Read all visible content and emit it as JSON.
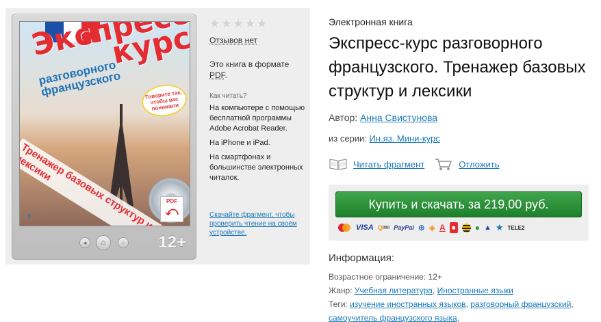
{
  "cover": {
    "title_line1": "Экспресс-",
    "title_line2": "курс",
    "subtitle": "разговорного французского",
    "note": "Говорите так, чтобы вас понимали",
    "diagonal_text": "Тренажер базовых структур и лексики",
    "pdf_badge": "PDF",
    "publisher_mark": "э"
  },
  "device": {
    "age_badge": "12+"
  },
  "panel": {
    "stars": "★★★★★",
    "reviews": "Отзывов нет",
    "format_prefix": "Это книга в формате ",
    "format_pdf": "PDF",
    "format_suffix": ".",
    "howto_label": "Как читать?",
    "howto_computer": "На компьютере с помощью бесплатной программы Adobe Acrobat Reader.",
    "howto_iphone": "На iPhone и iPad.",
    "howto_phones": "На смартфонах и большинстве электронных читалок.",
    "fragment_link": "Скачайте фрагмент, чтобы проверить чтение на своём устройстве."
  },
  "book": {
    "type_label": "Электронная книга",
    "title": "Экспресс-курс разговорного французского. Тренажер базовых структур и лексики",
    "author_label": "Автор: ",
    "author_name": "Анна Свистунова",
    "series_label": "из серии: ",
    "series_name": "Ин.яз. Мини-курс"
  },
  "actions": {
    "read_fragment": "Читать фрагмент",
    "defer": "Отложить"
  },
  "buy": {
    "button_label": "Купить и скачать за 219,00 руб.",
    "payment_methods": [
      "MasterCard",
      "VISA",
      "QIWI",
      "PayPal",
      "WebMoney",
      "Яндекс",
      "A",
      "МТС",
      "Билайн",
      "Мегафон",
      "Сбербанк",
      "Tele2 звезда",
      "TELE2"
    ]
  },
  "info": {
    "heading": "Информация:",
    "age_label": "Возрастное ограничение: ",
    "age_value": "12+",
    "genre_label": "Жанр: ",
    "genre_1": "Учебная литература",
    "genre_sep": ", ",
    "genre_2": "Иностранные языки",
    "tags_label": "Теги: ",
    "tag_1": "изучение иностранных языков",
    "tag_2": "разговорный французский",
    "tag_3": "самоучитель французского языка",
    "tag_sep": ", ",
    "tag_trailing": ","
  },
  "colors": {
    "buy_green": "#2e9a3c",
    "link_blue": "#1a78b8",
    "panel_gray": "#eeeeee"
  }
}
